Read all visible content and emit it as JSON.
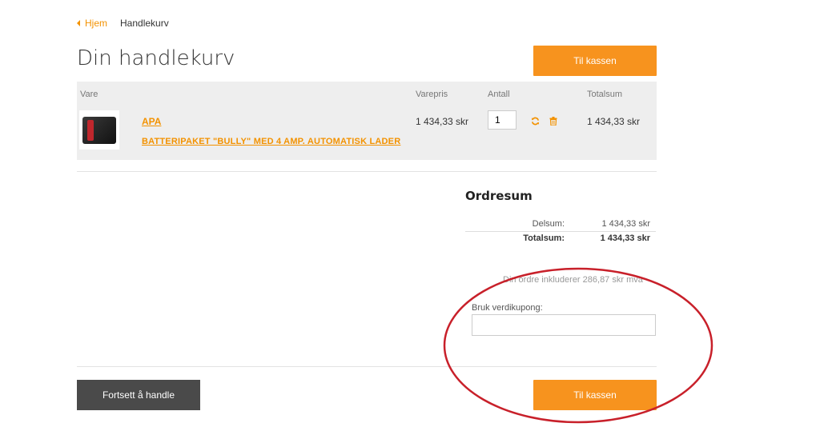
{
  "breadcrumb": {
    "home": "Hjem",
    "current": "Handlekurv"
  },
  "page_title": "Din handlekurv",
  "checkout_label": "Til kassen",
  "table": {
    "headers": {
      "item": "Vare",
      "unit_price": "Varepris",
      "quantity": "Antall",
      "total": "Totalsum"
    },
    "rows": [
      {
        "brand": "APA",
        "name": "BATTERIPAKET \"BULLY\" MED 4 AMP. AUTOMATISK LADER",
        "unit_price": "1 434,33 skr",
        "quantity": "1",
        "total": "1 434,33 skr"
      }
    ]
  },
  "summary": {
    "title": "Ordresum",
    "subtotal_label": "Delsum:",
    "subtotal_value": "1 434,33 skr",
    "total_label": "Totalsum:",
    "total_value": "1 434,33 skr",
    "vat_note": "Din ordre inkluderer 286,87 skr mva"
  },
  "coupon": {
    "label": "Bruk verdikupong:",
    "value": ""
  },
  "continue_label": "Fortsett å handle",
  "colors": {
    "accent": "#f7931e",
    "dark_button": "#4a4a4a",
    "annotation": "#c8202a"
  },
  "icons": {
    "refresh": "refresh-icon",
    "delete": "trash-icon",
    "back": "caret-left-icon"
  }
}
